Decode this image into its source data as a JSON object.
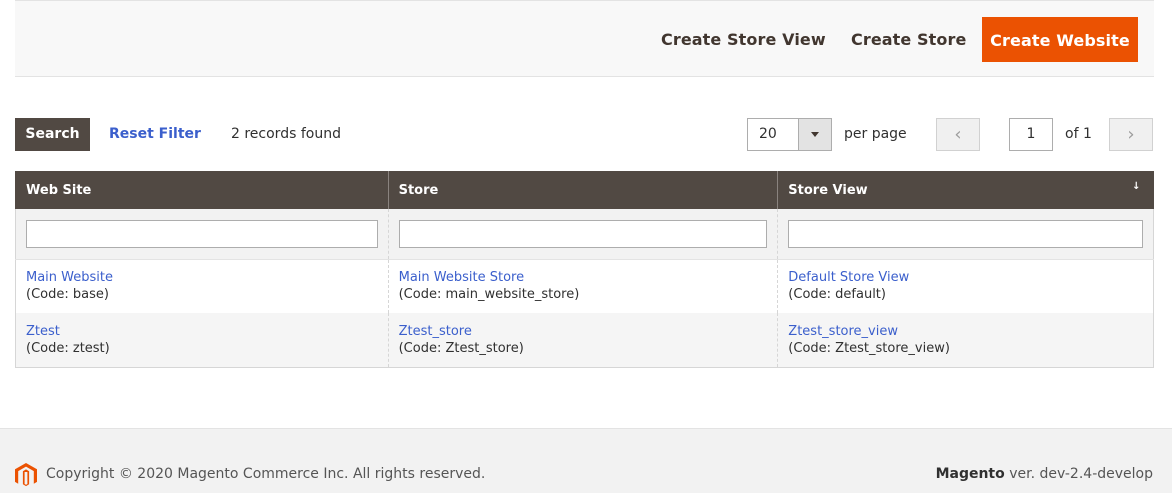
{
  "actions": {
    "create_store_view": "Create Store View",
    "create_store": "Create Store",
    "create_website": "Create Website"
  },
  "toolbar": {
    "search_label": "Search",
    "reset_filter_label": "Reset Filter",
    "records_found": "2 records found",
    "per_page_value": "20",
    "per_page_label": "per page",
    "prev_icon": "‹",
    "next_icon": "›",
    "current_page": "1",
    "page_total": "of 1"
  },
  "grid": {
    "columns": [
      "Web Site",
      "Store",
      "Store View"
    ],
    "sort_indicator": "↓",
    "rows": [
      {
        "website": {
          "name": "Main Website",
          "code": "(Code: base)"
        },
        "store": {
          "name": "Main Website Store",
          "code": "(Code: main_website_store)"
        },
        "store_view": {
          "name": "Default Store View",
          "code": "(Code: default)"
        }
      },
      {
        "website": {
          "name": "Ztest",
          "code": "(Code: ztest)"
        },
        "store": {
          "name": "Ztest_store",
          "code": "(Code: Ztest_store)"
        },
        "store_view": {
          "name": "Ztest_store_view",
          "code": "(Code: Ztest_store_view)"
        }
      }
    ]
  },
  "footer": {
    "copyright": "Copyright © 2020 Magento Commerce Inc. All rights reserved.",
    "brand": "Magento",
    "version": " ver. dev-2.4-develop"
  },
  "colors": {
    "accent": "#eb5202",
    "header_bg": "#514943",
    "link": "#3b5fcc"
  }
}
